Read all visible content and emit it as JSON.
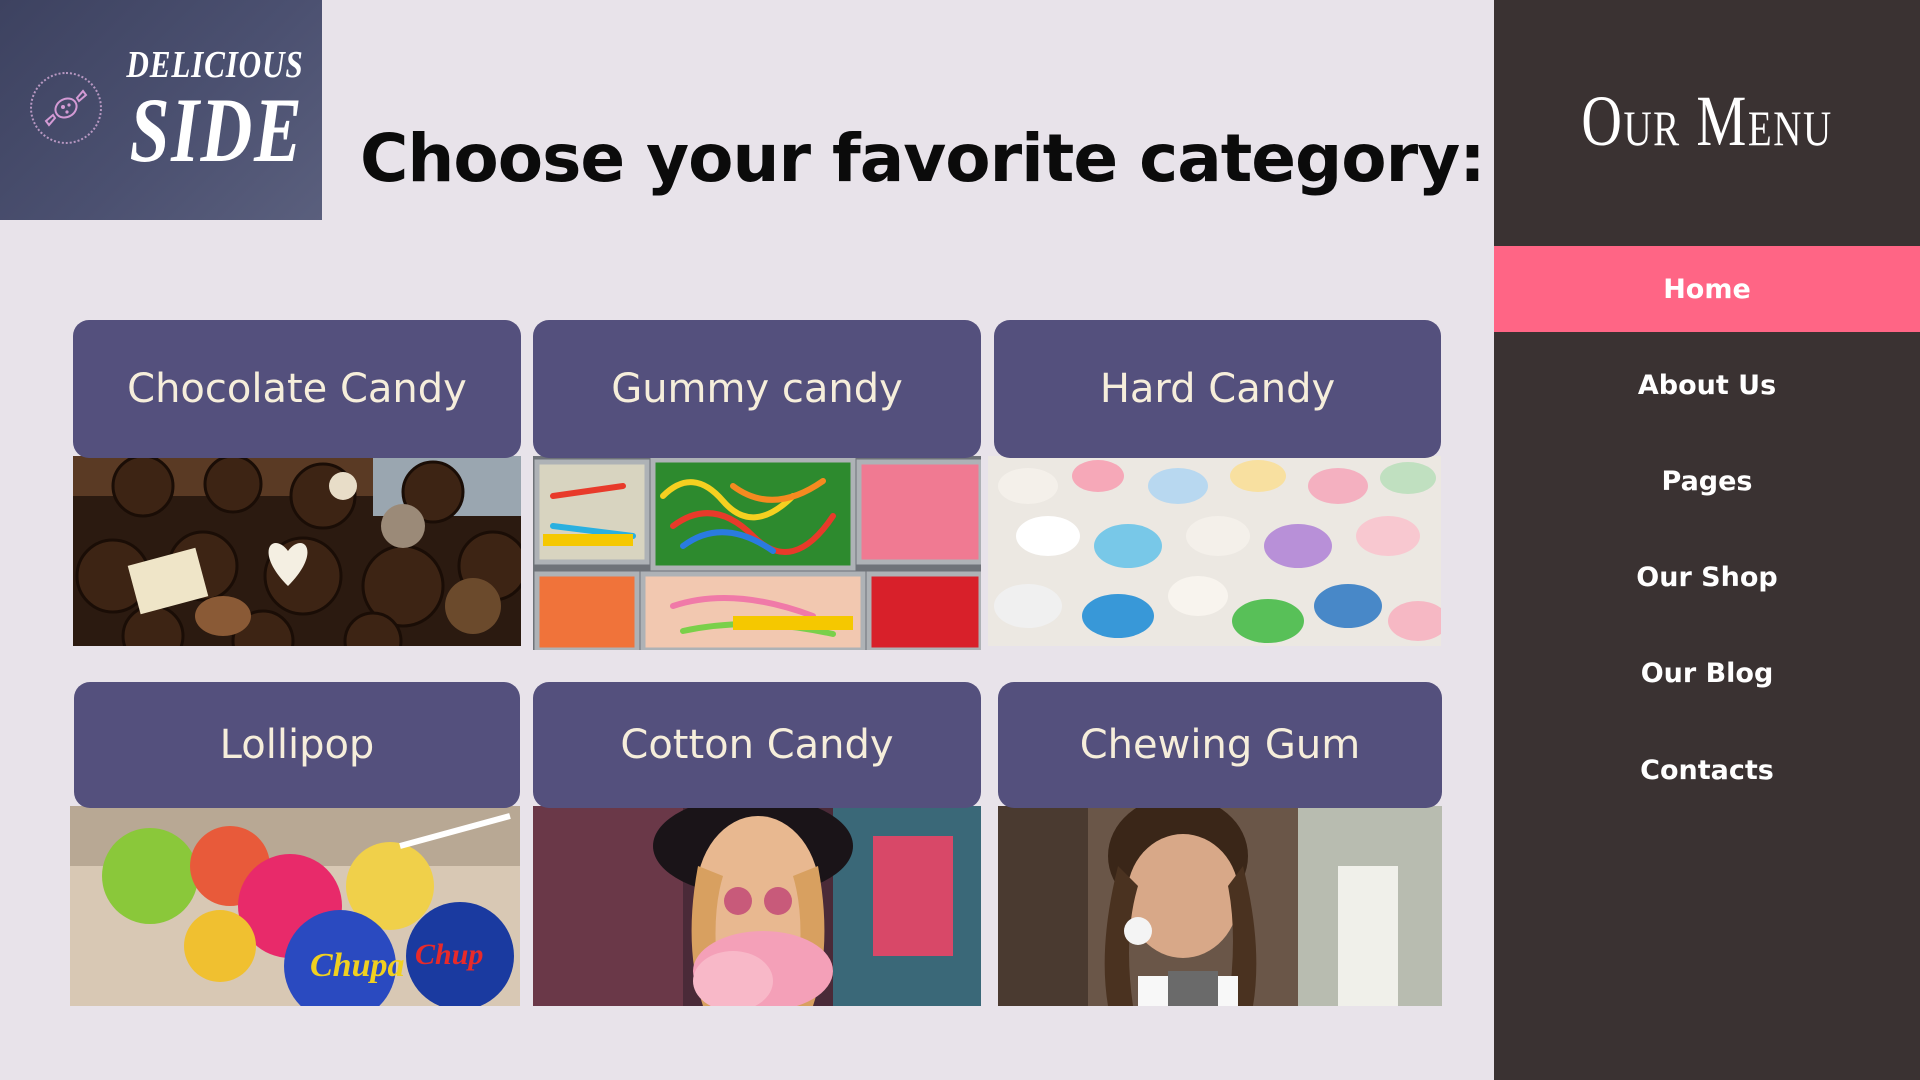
{
  "logo": {
    "line1": "DELICIOUS",
    "line2": "SIDE",
    "icon": "candy-icon"
  },
  "heading": "Choose your favorite category:",
  "categories": [
    {
      "label": "Chocolate Candy",
      "image": "chocolate-candy-photo"
    },
    {
      "label": "Gummy candy",
      "image": "gummy-candy-photo"
    },
    {
      "label": "Hard Candy",
      "image": "hard-candy-photo"
    },
    {
      "label": "Lollipop",
      "image": "lollipop-photo"
    },
    {
      "label": "Cotton Candy",
      "image": "cotton-candy-photo"
    },
    {
      "label": "Chewing Gum",
      "image": "chewing-gum-photo"
    }
  ],
  "sidebar": {
    "title": "Our Menu",
    "items": [
      {
        "label": "Home",
        "active": true
      },
      {
        "label": "About Us",
        "active": false
      },
      {
        "label": "Pages",
        "active": false
      },
      {
        "label": "Our Shop",
        "active": false
      },
      {
        "label": "Our Blog",
        "active": false
      },
      {
        "label": "Contacts",
        "active": false
      }
    ]
  },
  "colors": {
    "background": "#e8e3ea",
    "card_label": "#54507d",
    "card_text": "#f6eedb",
    "sidebar": "#3a3232",
    "active_item": "#ff6585"
  }
}
